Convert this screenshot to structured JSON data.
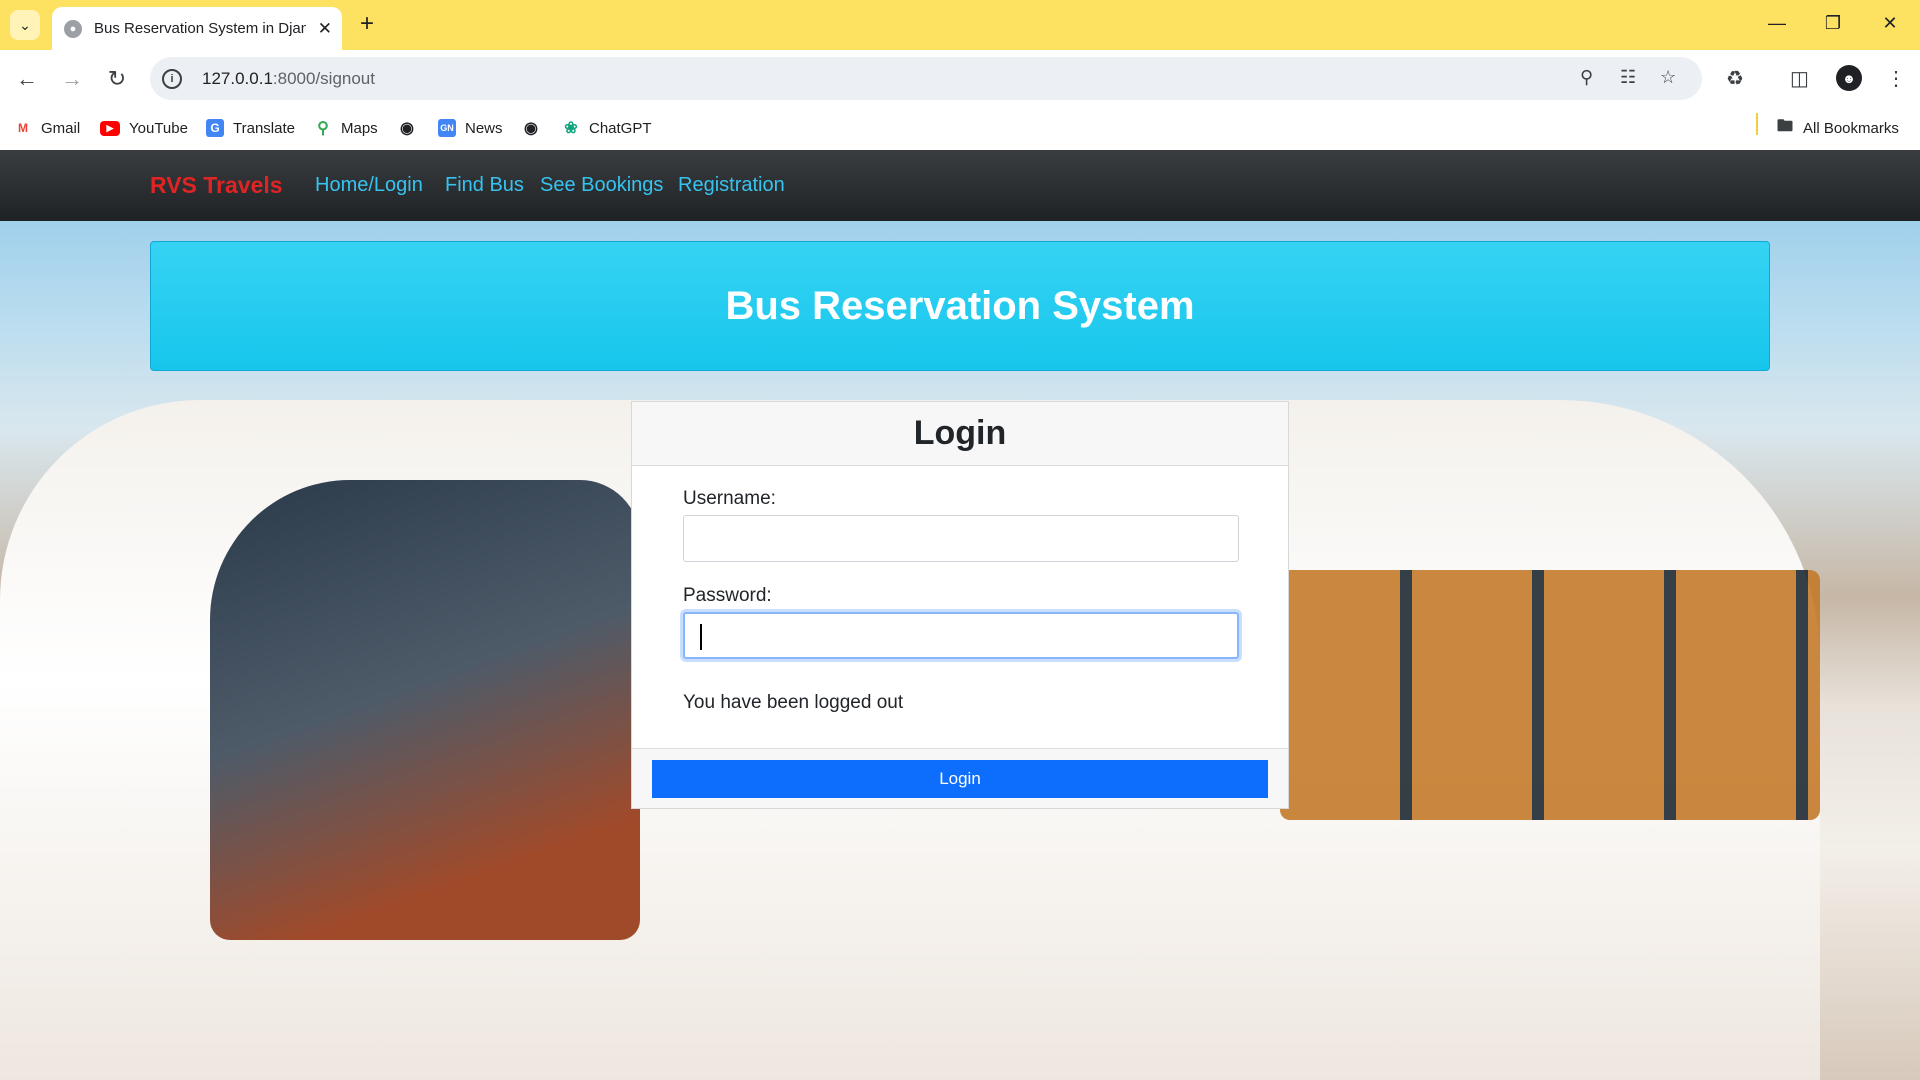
{
  "browser": {
    "tab_title": "Bus Reservation System in Djan",
    "url_host": "127.0.0.1",
    "url_path": ":8000/signout",
    "bookmarks": [
      {
        "label": "Gmail",
        "icon": "gmail-icon"
      },
      {
        "label": "YouTube",
        "icon": "youtube-icon"
      },
      {
        "label": "Translate",
        "icon": "translate-icon"
      },
      {
        "label": "Maps",
        "icon": "maps-icon"
      },
      {
        "label": "",
        "icon": "globe-icon"
      },
      {
        "label": "News",
        "icon": "news-icon"
      },
      {
        "label": "",
        "icon": "globe-icon"
      },
      {
        "label": "ChatGPT",
        "icon": "chatgpt-icon"
      }
    ],
    "all_bookmarks": "All Bookmarks"
  },
  "navbar": {
    "brand": "RVS Travels",
    "links": [
      "Home/Login",
      "Find Bus",
      "See Bookings",
      "Registration"
    ]
  },
  "banner": {
    "title": "Bus Reservation System"
  },
  "login": {
    "title": "Login",
    "username_label": "Username:",
    "username_value": "",
    "password_label": "Password:",
    "password_value": "",
    "message": "You have been logged out",
    "submit_label": "Login"
  },
  "colors": {
    "brand": "#e02424",
    "nav_link": "#37c3f0",
    "banner": "#1ec9ee",
    "primary_button": "#0d6efd",
    "titlebar": "#fde262"
  }
}
